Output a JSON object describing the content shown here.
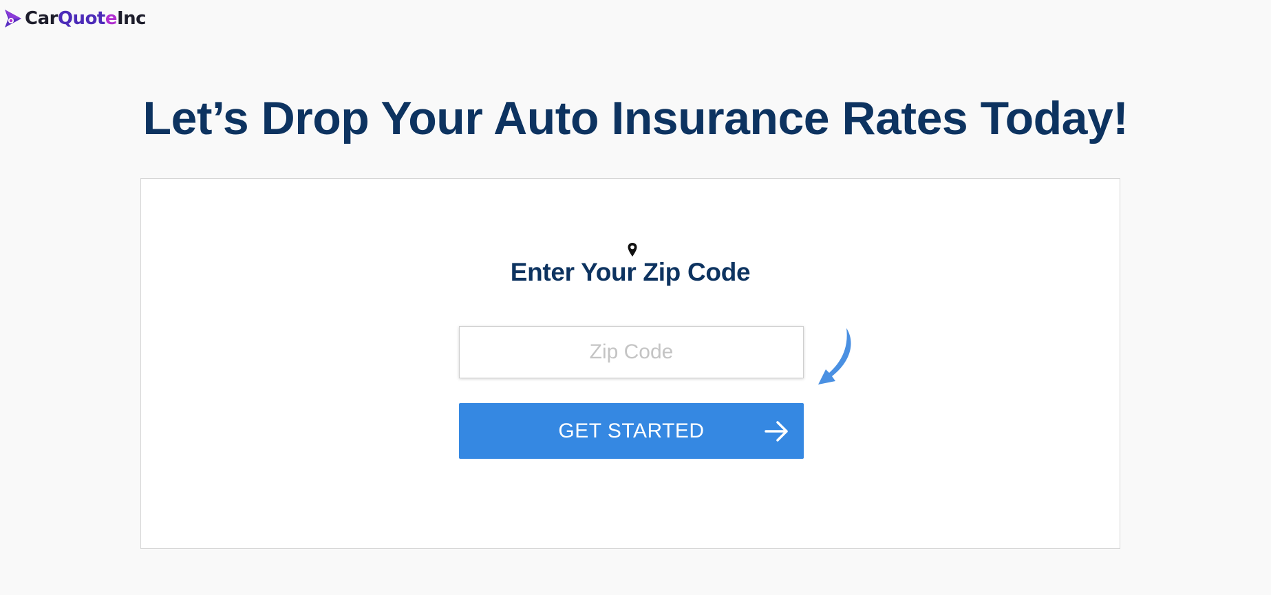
{
  "brand": {
    "part_car": "Car",
    "part_quot": "Quot",
    "part_e": "e",
    "part_inc": "Inc",
    "icon": "play-arrow-logo-icon",
    "colors": {
      "dark": "#1d1d2b",
      "indigo": "#4c2bb8",
      "violet": "#b12fd1"
    }
  },
  "headline": "Let’s Drop Your Auto Insurance Rates Today!",
  "form": {
    "location_icon": "map-pin-icon",
    "title": "Enter Your Zip Code",
    "zip_placeholder": "Zip Code",
    "zip_value": "",
    "hint_icon": "curved-arrow-down-left-icon",
    "submit_label": "GET STARTED",
    "submit_icon": "arrow-right-icon"
  },
  "colors": {
    "page_bg": "#f9f9f9",
    "heading": "#0d3360",
    "button_bg": "#3588e2",
    "hint_arrow": "#4a90e2"
  }
}
